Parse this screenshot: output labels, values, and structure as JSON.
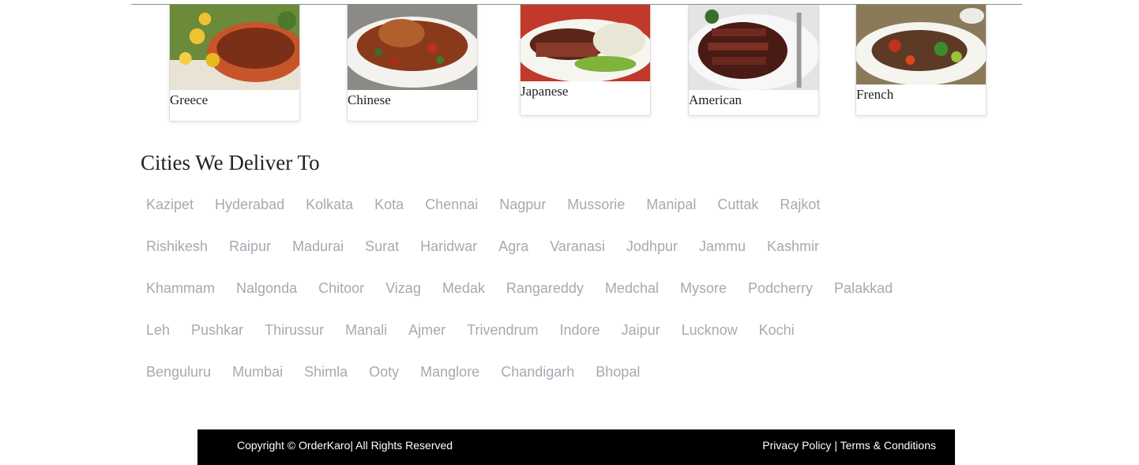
{
  "cuisines": [
    {
      "label": "Greece"
    },
    {
      "label": "Chinese"
    },
    {
      "label": "Japanese"
    },
    {
      "label": "American"
    },
    {
      "label": "French"
    }
  ],
  "cities_section": {
    "title": "Cities We Deliver To",
    "rows": [
      [
        "Kazipet",
        "Hyderabad",
        "Kolkata",
        "Kota",
        "Chennai",
        "Nagpur",
        "Mussorie",
        "Manipal",
        "Cuttak",
        "Rajkot"
      ],
      [
        "Rishikesh",
        "Raipur",
        "Madurai",
        "Surat",
        "Haridwar",
        "Agra",
        "Varanasi",
        "Jodhpur",
        "Jammu",
        "Kashmir"
      ],
      [
        "Khammam",
        "Nalgonda",
        "Chitoor",
        "Vizag",
        "Medak",
        "Rangareddy",
        "Medchal",
        "Mysore",
        "Podcherry",
        "Palakkad"
      ],
      [
        "Leh",
        "Pushkar",
        "Thirussur",
        "Manali",
        "Ajmer",
        "Trivendrum",
        "Indore",
        "Jaipur",
        "Lucknow",
        "Kochi"
      ],
      [
        "Benguluru",
        "Mumbai",
        "Shimla",
        "Ooty",
        "Manglore",
        "Chandigarh",
        "Bhopal"
      ]
    ]
  },
  "footer": {
    "copyright": "Copyright © OrderKaro| All Rights Reserved",
    "privacy": "Privacy Policy",
    "separator": " | ",
    "terms": "Terms & Conditions"
  }
}
